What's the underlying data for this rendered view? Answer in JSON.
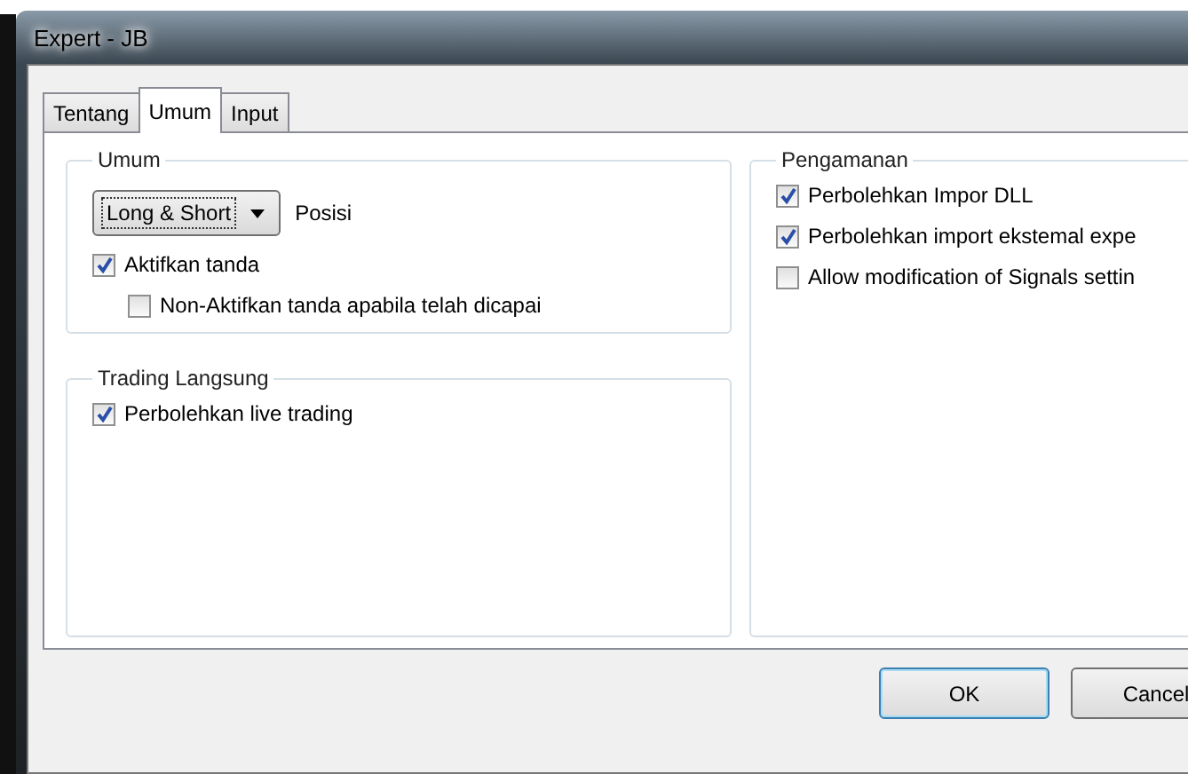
{
  "window": {
    "title": "Expert - JB"
  },
  "tabs": [
    {
      "label": "Tentang",
      "selected": false
    },
    {
      "label": "Umum",
      "selected": true
    },
    {
      "label": "Input",
      "selected": false
    }
  ],
  "groups": [
    {
      "title": "Umum",
      "items": [
        {
          "kind": "dropdown",
          "option": "Long & Short",
          "label": "Posisi"
        },
        {
          "kind": "checkbox",
          "label": "Aktifkan tanda",
          "checked": true,
          "indented": false
        },
        {
          "kind": "checkbox",
          "label": "Non-Aktifkan tanda apabila telah dicapai",
          "checked": false,
          "indented": true
        }
      ]
    },
    {
      "title": "Trading Langsung",
      "items": [
        {
          "kind": "checkbox",
          "label": "Perbolehkan live trading",
          "checked": true,
          "indented": false
        }
      ]
    },
    {
      "title": "Pengamanan",
      "items": [
        {
          "kind": "checkbox",
          "label": "Perbolehkan Impor DLL",
          "checked": true,
          "indented": false
        },
        {
          "kind": "checkbox",
          "label": "Perbolehkan import ekstemal expe",
          "checked": true,
          "indented": false
        },
        {
          "kind": "checkbox",
          "label": "Allow modification of Signals settin",
          "checked": false,
          "indented": false
        }
      ]
    }
  ],
  "buttons": [
    {
      "label": "OK",
      "default": true
    },
    {
      "label": "Cancel",
      "default": false
    }
  ]
}
